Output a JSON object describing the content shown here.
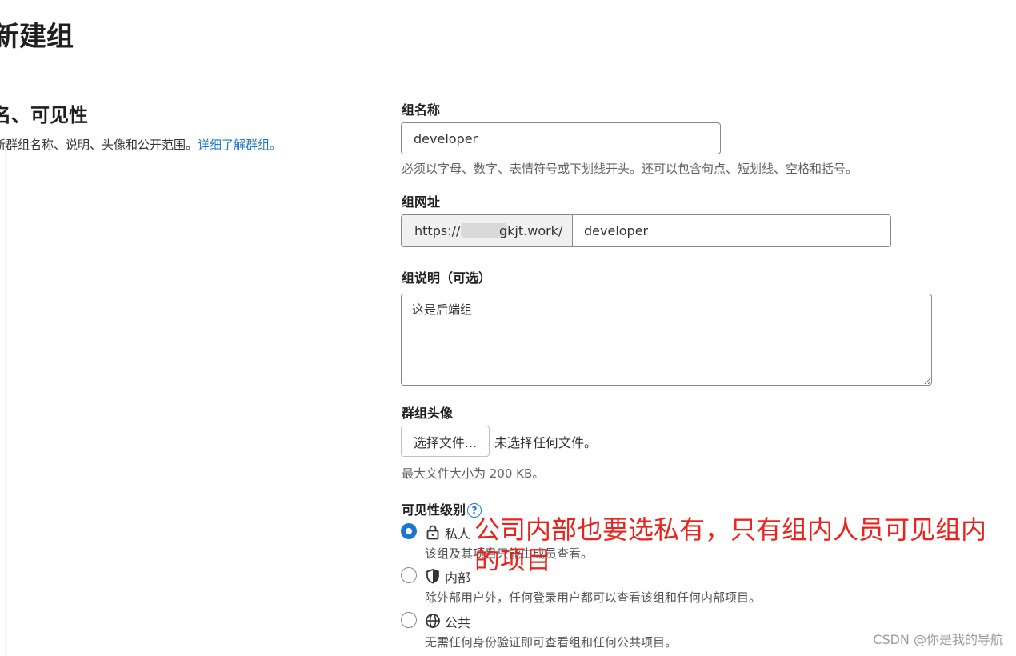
{
  "page": {
    "title": "新建组"
  },
  "section": {
    "title": "名、可见性",
    "description": "新群组名称、说明、头像和公开范围。",
    "learn_more_link": "详细了解群组。"
  },
  "form": {
    "group_name": {
      "label": "组名称",
      "value": "developer",
      "help": "必须以字母、数字、表情符号或下划线开头。还可以包含句点、短划线、空格和括号。"
    },
    "group_url": {
      "label": "组网址",
      "prefix_start": "https://",
      "prefix_end": "gkjt.work/",
      "value": "developer"
    },
    "description": {
      "label": "组说明（可选）",
      "value": "这是后端组"
    },
    "avatar": {
      "label": "群组头像",
      "button_label": "选择文件...",
      "status": "未选择任何文件。",
      "help": "最大文件大小为 200 KB。"
    },
    "visibility": {
      "label": "可见性级别",
      "help_icon": "question-circle-icon",
      "options": [
        {
          "label": "私人",
          "description": "该组及其项目只能由成员查看。",
          "icon": "lock-icon",
          "checked": true
        },
        {
          "label": "内部",
          "description": "除外部用户外，任何登录用户都可以查看该组和任何内部项目。",
          "icon": "shield-icon",
          "checked": false
        },
        {
          "label": "公共",
          "description": "无需任何身份验证即可查看组和任何公共项目。",
          "icon": "globe-icon",
          "checked": false
        }
      ]
    }
  },
  "annotation": "公司内部也要选私有，只有组内人员可见组内的项目",
  "watermark": "CSDN @你是我的导航",
  "colors": {
    "accent": "#1f75cb",
    "annotation": "#e8241e"
  }
}
